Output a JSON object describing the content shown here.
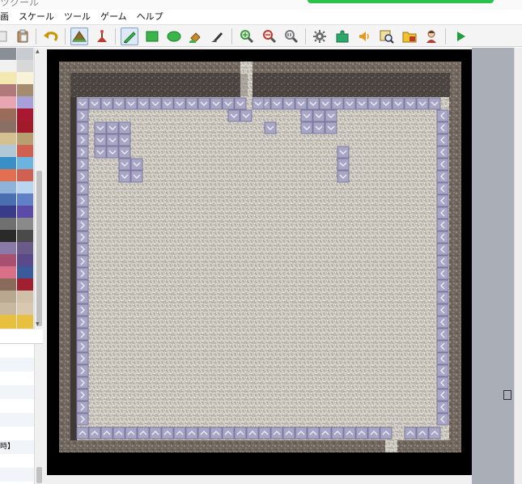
{
  "window": {
    "title": "ツクール"
  },
  "menu": {
    "items": [
      "画",
      "スケール",
      "ツール",
      "ゲーム",
      "ヘルプ"
    ]
  },
  "toolbar": {
    "buttons": [
      {
        "name": "new-icon"
      },
      {
        "name": "paste-icon"
      },
      {
        "name": "undo-icon"
      },
      {
        "name": "map-layer-icon"
      },
      {
        "name": "event-layer-icon"
      },
      {
        "name": "pencil-icon"
      },
      {
        "name": "rectangle-icon"
      },
      {
        "name": "ellipse-icon"
      },
      {
        "name": "fill-icon"
      },
      {
        "name": "shadow-pen-icon"
      },
      {
        "name": "zoom-in-icon"
      },
      {
        "name": "zoom-out-icon"
      },
      {
        "name": "zoom-actual-icon"
      },
      {
        "name": "database-icon"
      },
      {
        "name": "plugin-icon"
      },
      {
        "name": "sound-icon"
      },
      {
        "name": "event-search-icon"
      },
      {
        "name": "resource-manager-icon"
      },
      {
        "name": "character-generator-icon"
      },
      {
        "name": "playtest-icon"
      }
    ]
  },
  "tree": {
    "rows": [
      "",
      "",
      "",
      "",
      "",
      "",
      "",
      "",
      "時】",
      "",
      ""
    ]
  },
  "colors": {
    "grass_green": "#39b54a",
    "playtest_green": "#1f9e3c",
    "zoom_green": "#3a9a3a",
    "map_background": "#000000",
    "floor_tile": "#d4d0c8",
    "block_tile": "#a8a6c4",
    "rock_wall": "#7a6f66",
    "void_area": "#a9aeb7"
  }
}
